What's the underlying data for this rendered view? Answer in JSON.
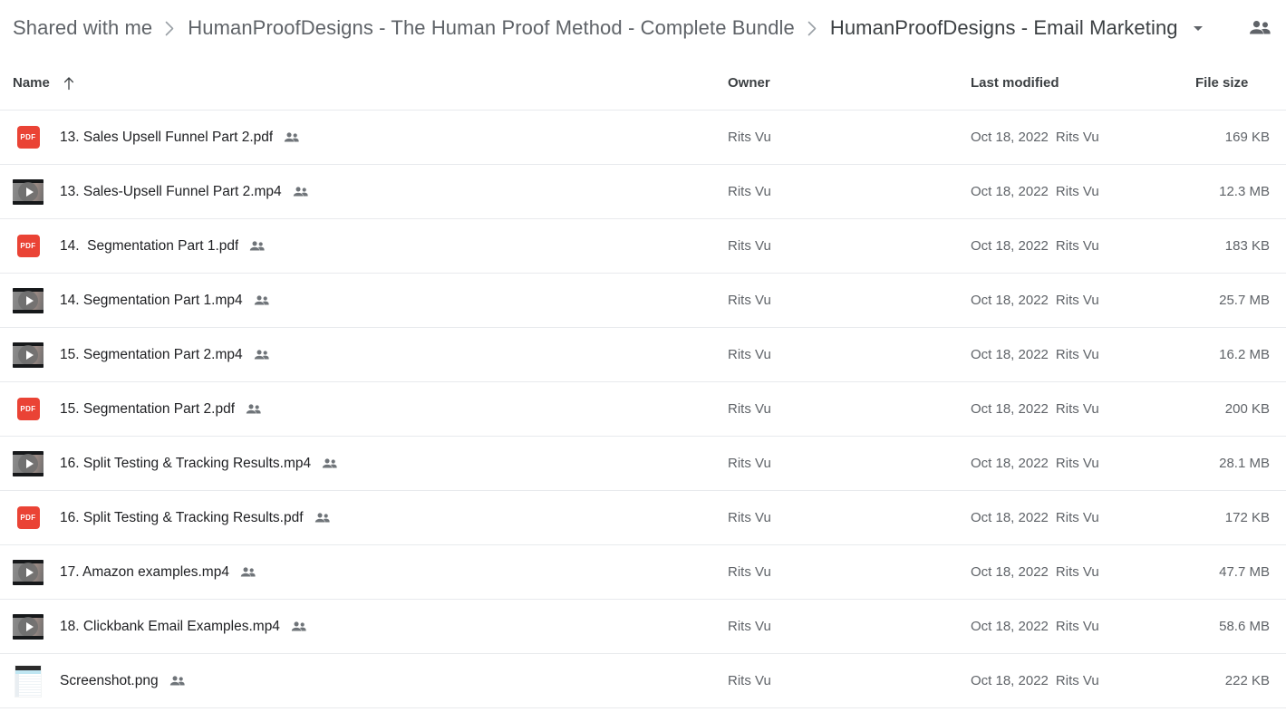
{
  "breadcrumb": {
    "items": [
      {
        "label": "Shared with me"
      },
      {
        "label": "HumanProofDesigns - The Human Proof Method - Complete Bundle"
      },
      {
        "label": "HumanProofDesigns - Email Marketing"
      }
    ],
    "separator": "chevron-right-icon",
    "dropdown_icon": "chevron-down-icon",
    "shared_icon": "people-shared-icon"
  },
  "columns": {
    "name": "Name",
    "name_sort": "arrow-up-icon",
    "owner": "Owner",
    "last_modified": "Last modified",
    "file_size": "File size"
  },
  "colors": {
    "pdf_red": "#ea4335",
    "text_primary": "#202124",
    "text_secondary": "#5f6368",
    "divider": "#e8eaed"
  },
  "files": [
    {
      "icon": "pdf-file-icon",
      "name": "13. Sales Upsell Funnel Part 2.pdf",
      "shared_icon": "people-shared-icon",
      "owner": "Rits Vu",
      "modified_date": "Oct 18, 2022",
      "modified_by": "Rits Vu",
      "size": "169 KB"
    },
    {
      "icon": "video-file-icon",
      "name": "13. Sales-Upsell Funnel Part 2.mp4",
      "shared_icon": "people-shared-icon",
      "owner": "Rits Vu",
      "modified_date": "Oct 18, 2022",
      "modified_by": "Rits Vu",
      "size": "12.3 MB"
    },
    {
      "icon": "pdf-file-icon",
      "name": "14.  Segmentation Part 1.pdf",
      "shared_icon": "people-shared-icon",
      "owner": "Rits Vu",
      "modified_date": "Oct 18, 2022",
      "modified_by": "Rits Vu",
      "size": "183 KB"
    },
    {
      "icon": "video-file-icon",
      "name": "14. Segmentation Part 1.mp4",
      "shared_icon": "people-shared-icon",
      "owner": "Rits Vu",
      "modified_date": "Oct 18, 2022",
      "modified_by": "Rits Vu",
      "size": "25.7 MB"
    },
    {
      "icon": "video-file-icon",
      "name": "15. Segmentation Part 2.mp4",
      "shared_icon": "people-shared-icon",
      "owner": "Rits Vu",
      "modified_date": "Oct 18, 2022",
      "modified_by": "Rits Vu",
      "size": "16.2 MB"
    },
    {
      "icon": "pdf-file-icon",
      "name": "15. Segmentation Part 2.pdf",
      "shared_icon": "people-shared-icon",
      "owner": "Rits Vu",
      "modified_date": "Oct 18, 2022",
      "modified_by": "Rits Vu",
      "size": "200 KB"
    },
    {
      "icon": "video-file-icon",
      "name": "16. Split Testing & Tracking Results.mp4",
      "shared_icon": "people-shared-icon",
      "owner": "Rits Vu",
      "modified_date": "Oct 18, 2022",
      "modified_by": "Rits Vu",
      "size": "28.1 MB"
    },
    {
      "icon": "pdf-file-icon",
      "name": "16. Split Testing & Tracking Results.pdf",
      "shared_icon": "people-shared-icon",
      "owner": "Rits Vu",
      "modified_date": "Oct 18, 2022",
      "modified_by": "Rits Vu",
      "size": "172 KB"
    },
    {
      "icon": "video-file-icon",
      "name": "17. Amazon examples.mp4",
      "shared_icon": "people-shared-icon",
      "owner": "Rits Vu",
      "modified_date": "Oct 18, 2022",
      "modified_by": "Rits Vu",
      "size": "47.7 MB"
    },
    {
      "icon": "video-file-icon",
      "name": "18. Clickbank Email Examples.mp4",
      "shared_icon": "people-shared-icon",
      "owner": "Rits Vu",
      "modified_date": "Oct 18, 2022",
      "modified_by": "Rits Vu",
      "size": "58.6 MB"
    },
    {
      "icon": "image-file-icon",
      "name": "Screenshot.png",
      "shared_icon": "people-shared-icon",
      "owner": "Rits Vu",
      "modified_date": "Oct 18, 2022",
      "modified_by": "Rits Vu",
      "size": "222 KB"
    }
  ]
}
